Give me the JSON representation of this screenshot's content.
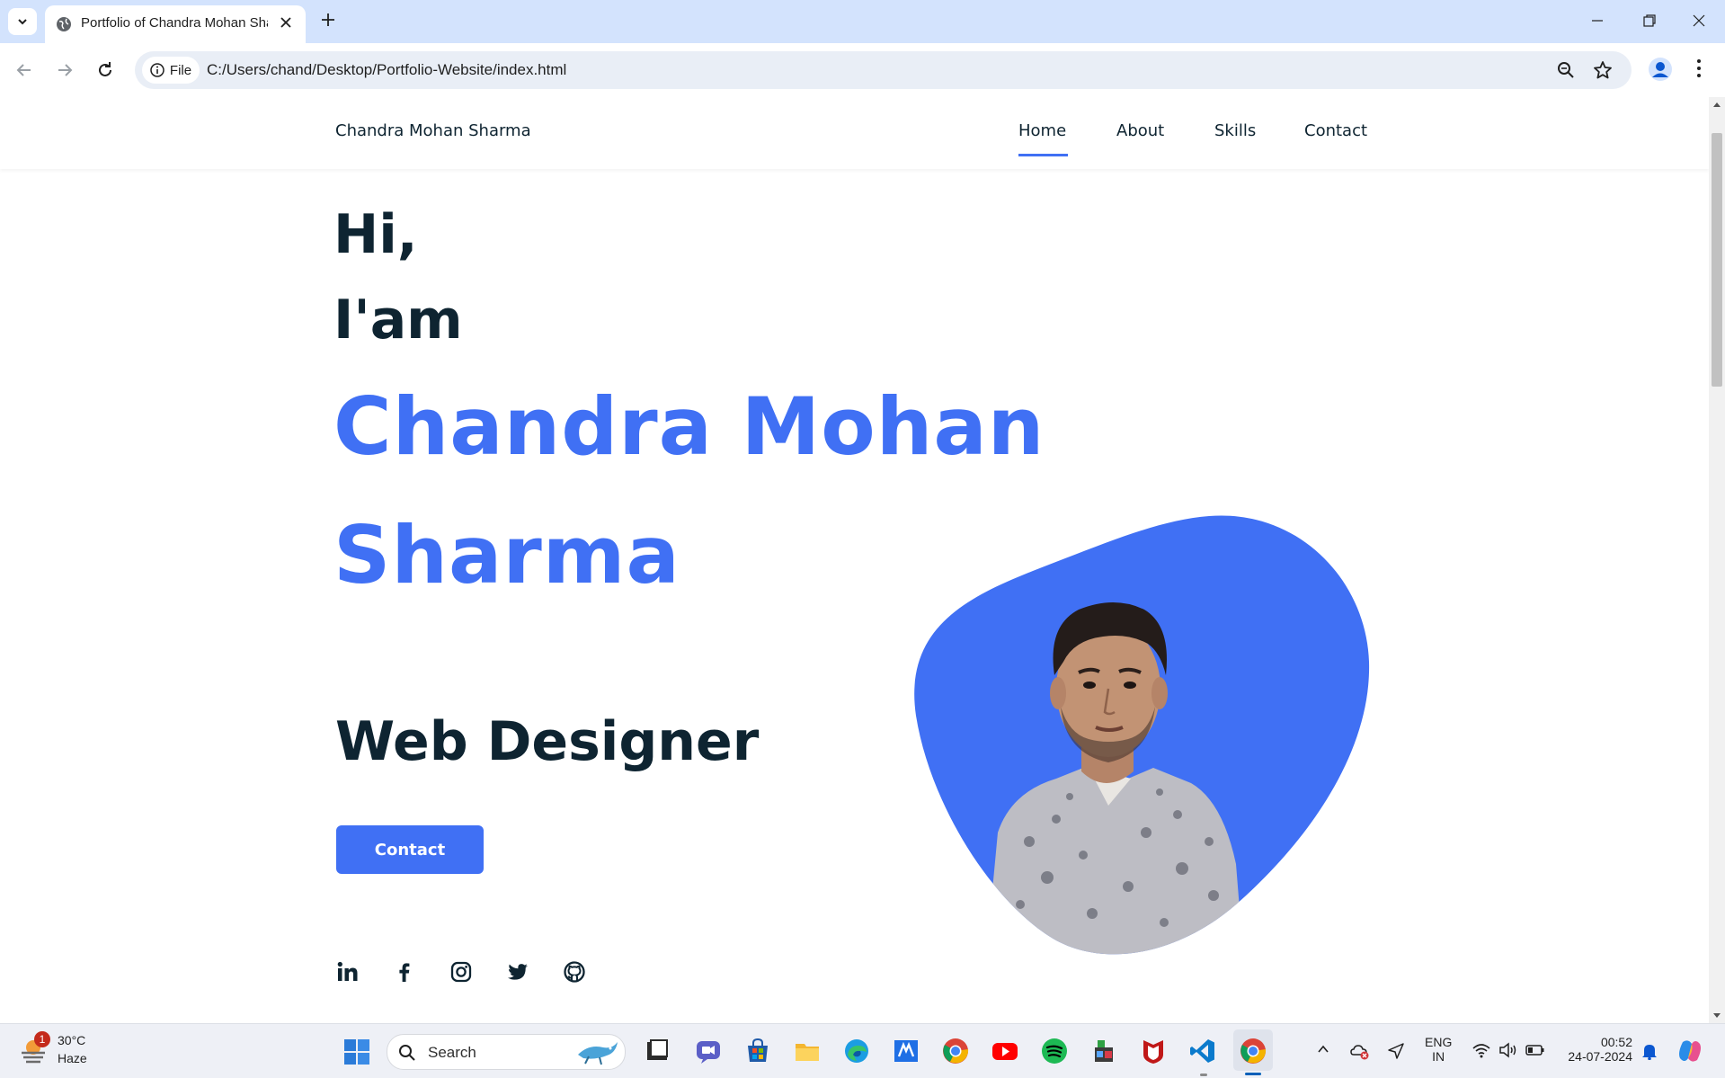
{
  "browser": {
    "tab_title": "Portfolio of Chandra Mohan Sharma",
    "site_chip_label": "File",
    "url": "C:/Users/chand/Desktop/Portfolio-Website/index.html"
  },
  "page": {
    "logo": "Chandra Mohan Sharma",
    "nav": {
      "home": "Home",
      "about": "About",
      "skills": "Skills",
      "contact": "Contact",
      "active": "Home"
    },
    "hero": {
      "greeting": "Hi,",
      "intro": "I'am",
      "name_line1": "Chandra Mohan",
      "name_line2": "Sharma",
      "role": "Web Designer",
      "contact_button": "Contact"
    },
    "social_icons": [
      "linkedin-icon",
      "facebook-icon",
      "instagram-icon",
      "twitter-icon",
      "github-icon"
    ],
    "colors": {
      "accent": "#4070f4",
      "heading": "#0e2431"
    }
  },
  "taskbar": {
    "weather_temp": "30°C",
    "weather_desc": "Haze",
    "weather_badge": "1",
    "search_label": "Search",
    "language_line1": "ENG",
    "language_line2": "IN",
    "time": "00:52",
    "date": "24-07-2024",
    "pinned_apps": [
      "file-explorer",
      "teams",
      "microsoft-store",
      "folder",
      "edge",
      "visual-studio",
      "chrome",
      "youtube",
      "spotify",
      "game",
      "mcafee",
      "vscode",
      "chrome-active"
    ]
  }
}
